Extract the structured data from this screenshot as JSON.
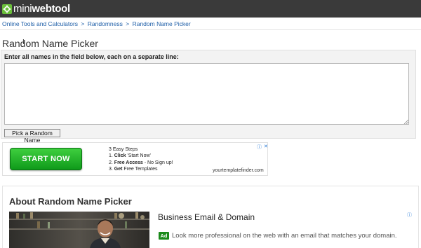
{
  "header": {
    "logo_light": "mini",
    "logo_bold": "webtool"
  },
  "breadcrumb": {
    "items": [
      "Online Tools and Calculators",
      "Randomness",
      "Random Name Picker"
    ],
    "separator": ">"
  },
  "page": {
    "title": "Random Name Picker"
  },
  "form": {
    "label": "Enter all names in the field below, each on a separate line:",
    "textarea_value": "",
    "button_label": "Pick a Random Name"
  },
  "ad_banner": {
    "cta_label": "START NOW",
    "steps_title": "3 Easy Steps",
    "step1_prefix": "1. ",
    "step1_bold": "Click",
    "step1_rest": " 'Start Now'",
    "step2_prefix": "2. ",
    "step2_bold": "Free Access",
    "step2_rest": " - No Sign up!",
    "step3_prefix": "3. ",
    "step3_bold": "Get",
    "step3_rest": " Free Templates",
    "url": "yourtemplatefinder.com",
    "info_glyph": "ⓘ",
    "close_glyph": "✕"
  },
  "about": {
    "title": "About Random Name Picker",
    "ad_title": "Business Email & Domain",
    "ad_badge": "Ad",
    "ad_text": "Look more professional on the web with an email that matches your domain.",
    "info_glyph": "ⓘ"
  },
  "colors": {
    "topbar": "#3a3a3a",
    "link": "#1f5fa8",
    "start_green": "#1fb02a",
    "ad_badge": "#1a8a1a",
    "adchoices_blue": "#2a7bd6"
  }
}
